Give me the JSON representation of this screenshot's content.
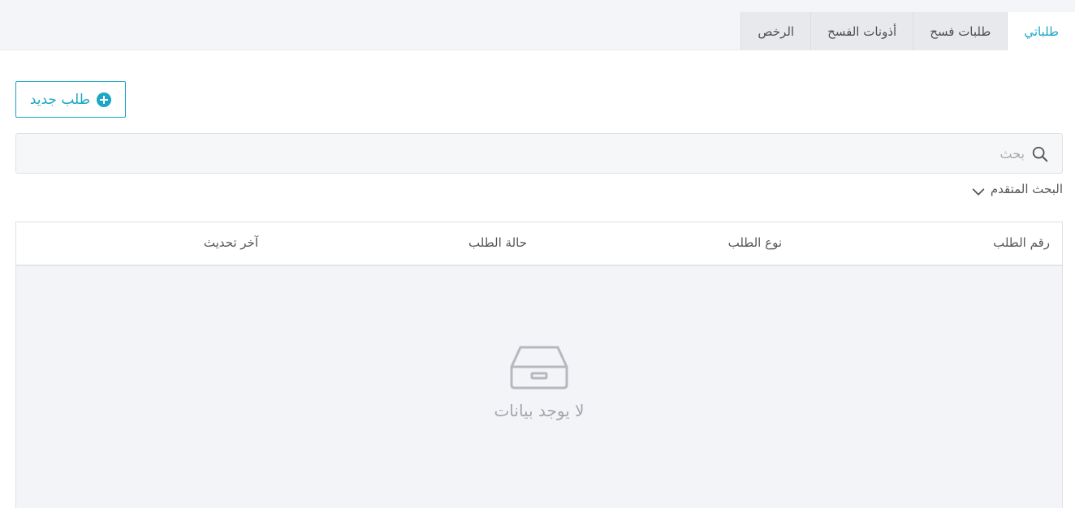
{
  "tabs": [
    {
      "label": "طلباتي",
      "active": true
    },
    {
      "label": "طلبات فسح",
      "active": false
    },
    {
      "label": "أذونات الفسح",
      "active": false
    },
    {
      "label": "الرخص",
      "active": false
    }
  ],
  "toolbar": {
    "new_request_label": "طلب جديد",
    "new_request_icon": "plus-circle-icon"
  },
  "search": {
    "placeholder": "بحث",
    "value": "",
    "icon": "search-icon",
    "advanced_label": "البحث المتقدم",
    "advanced_icon": "chevron-down-icon"
  },
  "table": {
    "columns": [
      "رقم الطلب",
      "نوع الطلب",
      "حالة الطلب",
      "آخر تحديث"
    ],
    "rows": [],
    "empty_text": "لا يوجد بيانات",
    "empty_icon": "inbox-icon"
  },
  "colors": {
    "accent": "#19a7c4",
    "tabbar_bg": "#f4f5f8",
    "inactive_tab_bg": "#e8e9ed",
    "table_body_bg": "#f3f4f7"
  }
}
